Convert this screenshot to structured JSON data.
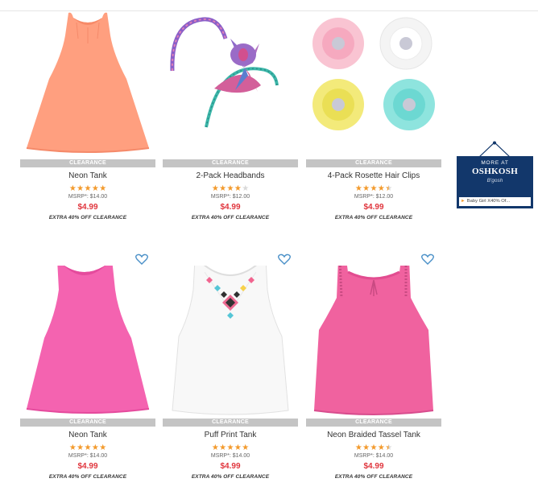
{
  "colors": {
    "accent_price": "#e0353d",
    "star": "#f39a2c",
    "clearance_bar": "#c4c4c4",
    "heart": "#4a90c8",
    "ad_bg": "#12376b"
  },
  "products": [
    {
      "badge": "CLEARANCE",
      "name": "Neon Tank",
      "rating": 5,
      "msrp": "MSRP*: $14.00",
      "price": "$4.99",
      "promo": "EXTRA 40% OFF CLEARANCE",
      "image": "orange-neon-tank",
      "favorite_icon": false
    },
    {
      "badge": "CLEARANCE",
      "name": "2-Pack Headbands",
      "rating": 4,
      "msrp": "MSRP*: $12.00",
      "price": "$4.99",
      "promo": "EXTRA 40% OFF CLEARANCE",
      "image": "headbands-with-bow",
      "favorite_icon": false
    },
    {
      "badge": "CLEARANCE",
      "name": "4-Pack Rosette Hair Clips",
      "rating": 4.5,
      "msrp": "MSRP*: $12.00",
      "price": "$4.99",
      "promo": "EXTRA 40% OFF CLEARANCE",
      "image": "rosette-hair-clips",
      "favorite_icon": false
    },
    {
      "badge": "CLEARANCE",
      "name": "Neon Tank",
      "rating": 5,
      "msrp": "MSRP*: $14.00",
      "price": "$4.99",
      "promo": "EXTRA 40% OFF CLEARANCE",
      "image": "pink-neon-tank",
      "favorite_icon": true
    },
    {
      "badge": "CLEARANCE",
      "name": "Puff Print Tank",
      "rating": 5,
      "msrp": "MSRP*: $14.00",
      "price": "$4.99",
      "promo": "EXTRA 40% OFF CLEARANCE",
      "image": "white-puff-print-tank",
      "favorite_icon": true
    },
    {
      "badge": "CLEARANCE",
      "name": "Neon Braided Tassel Tank",
      "rating": 4.5,
      "msrp": "MSRP*: $14.00",
      "price": "$4.99",
      "promo": "EXTRA 40% OFF CLEARANCE",
      "image": "pink-braided-tassel-tank",
      "favorite_icon": true
    }
  ],
  "ad": {
    "more_at": "MORE AT",
    "brand": "OSHKOSH",
    "brand_sub": "B'gosh",
    "link_text": "Baby Girl X40% Of..."
  }
}
